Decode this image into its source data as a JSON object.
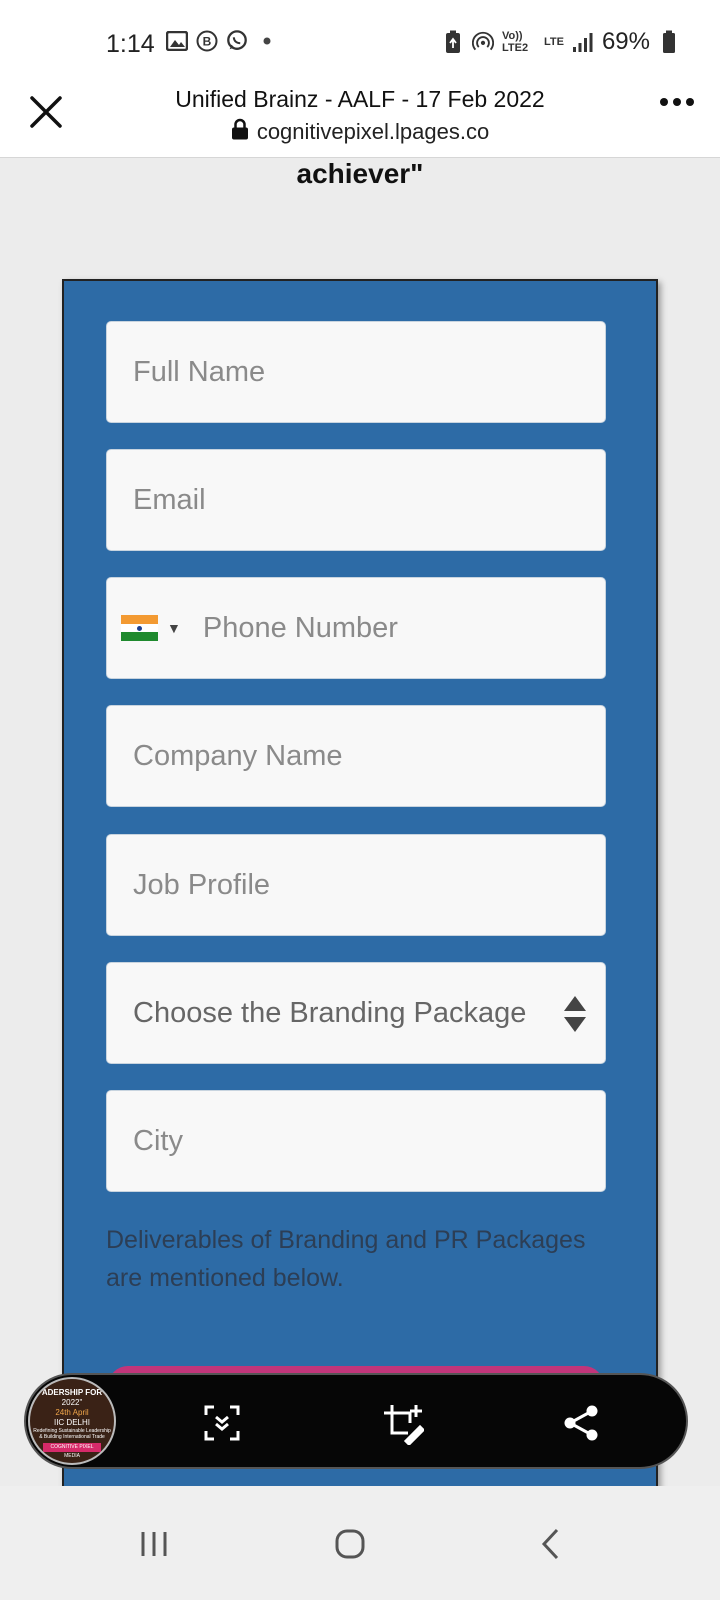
{
  "status_bar": {
    "time": "1:14",
    "network": "Vo)) LTE2",
    "lte": "LTE",
    "battery": "69%"
  },
  "browser": {
    "title": "Unified Brainz - AALF - 17 Feb 2022",
    "url": "cognitivepixel.lpages.co"
  },
  "page": {
    "heading_fragment": "achiever\"",
    "form": {
      "full_name_placeholder": "Full Name",
      "email_placeholder": "Email",
      "phone_placeholder": "Phone Number",
      "phone_country_flag": "india-flag-icon",
      "company_placeholder": "Company Name",
      "job_profile_placeholder": "Job Profile",
      "branding_package_select": "Choose the Branding Package",
      "city_placeholder": "City"
    },
    "deliverables_note": "Deliverables of Branding and PR Packages are mentioned below."
  },
  "capture_toolbar": {
    "thumbnail_lines": [
      "ADERSHIP FOR",
      "2022\"",
      "24th April",
      "IIC DELHI",
      "Redefining Sustainable Leadership",
      "& Building International Trade",
      "COGNITIVE PIXEL MEDIA"
    ]
  },
  "colors": {
    "form_panel": "#2d6ba6",
    "submit_button": "#c2357a",
    "page_background": "#ececec"
  }
}
